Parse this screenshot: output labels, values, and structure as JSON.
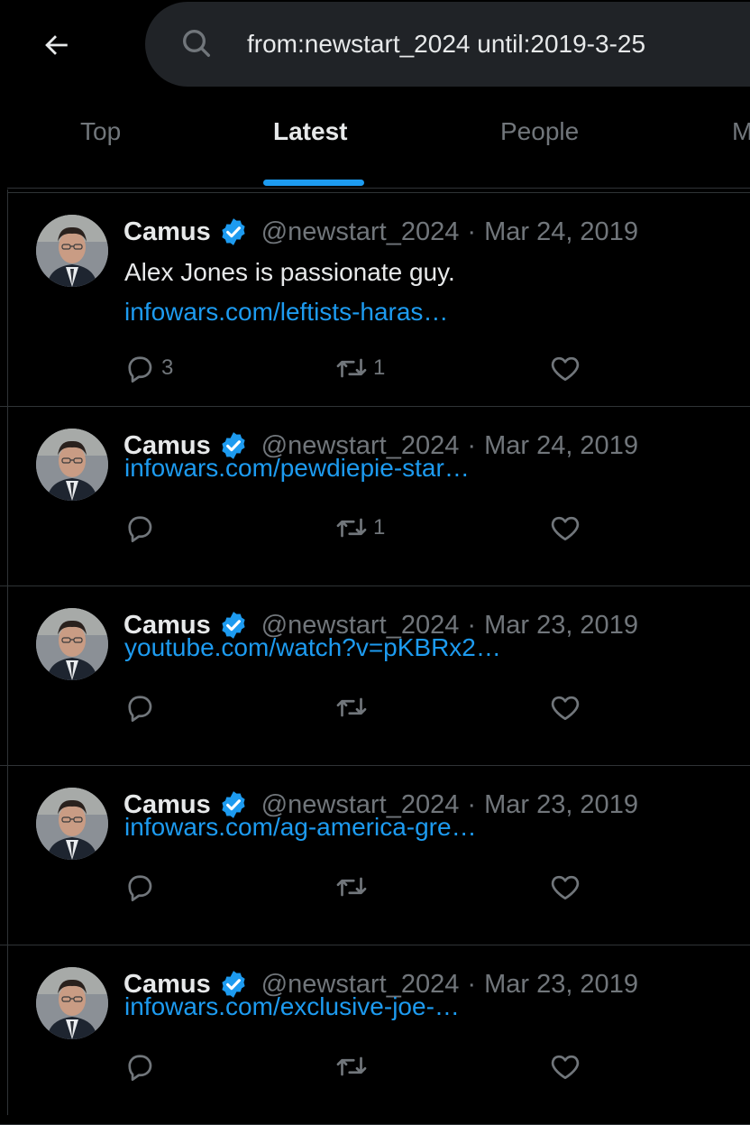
{
  "search": {
    "query": "from:newstart_2024 until:2019-3-25"
  },
  "tabs": [
    {
      "label": "Top",
      "active": false
    },
    {
      "label": "Latest",
      "active": true
    },
    {
      "label": "People",
      "active": false
    },
    {
      "label": "M",
      "active": false
    }
  ],
  "tweets": [
    {
      "name": "Camus",
      "handle": "@newstart_2024",
      "separator": "·",
      "date": "Mar 24, 2019",
      "text": "Alex Jones is passionate guy.",
      "link": "infowars.com/leftists-haras…",
      "reply_count": "3",
      "retweet_count": "1",
      "like_count": ""
    },
    {
      "name": "Camus",
      "handle": "@newstart_2024",
      "separator": "·",
      "date": "Mar 24, 2019",
      "text": "",
      "link": "infowars.com/pewdiepie-star…",
      "reply_count": "",
      "retweet_count": "1",
      "like_count": ""
    },
    {
      "name": "Camus",
      "handle": "@newstart_2024",
      "separator": "·",
      "date": "Mar 23, 2019",
      "text": "",
      "link": "youtube.com/watch?v=pKBRx2…",
      "reply_count": "",
      "retweet_count": "",
      "like_count": ""
    },
    {
      "name": "Camus",
      "handle": "@newstart_2024",
      "separator": "·",
      "date": "Mar 23, 2019",
      "text": "",
      "link": "infowars.com/ag-america-gre…",
      "reply_count": "",
      "retweet_count": "",
      "like_count": ""
    },
    {
      "name": "Camus",
      "handle": "@newstart_2024",
      "separator": "·",
      "date": "Mar 23, 2019",
      "text": "",
      "link": "infowars.com/exclusive-joe-…",
      "reply_count": "",
      "retweet_count": "",
      "like_count": ""
    }
  ],
  "colors": {
    "accent": "#1d9bf0",
    "background": "#000000",
    "secondary_text": "#71767b"
  }
}
